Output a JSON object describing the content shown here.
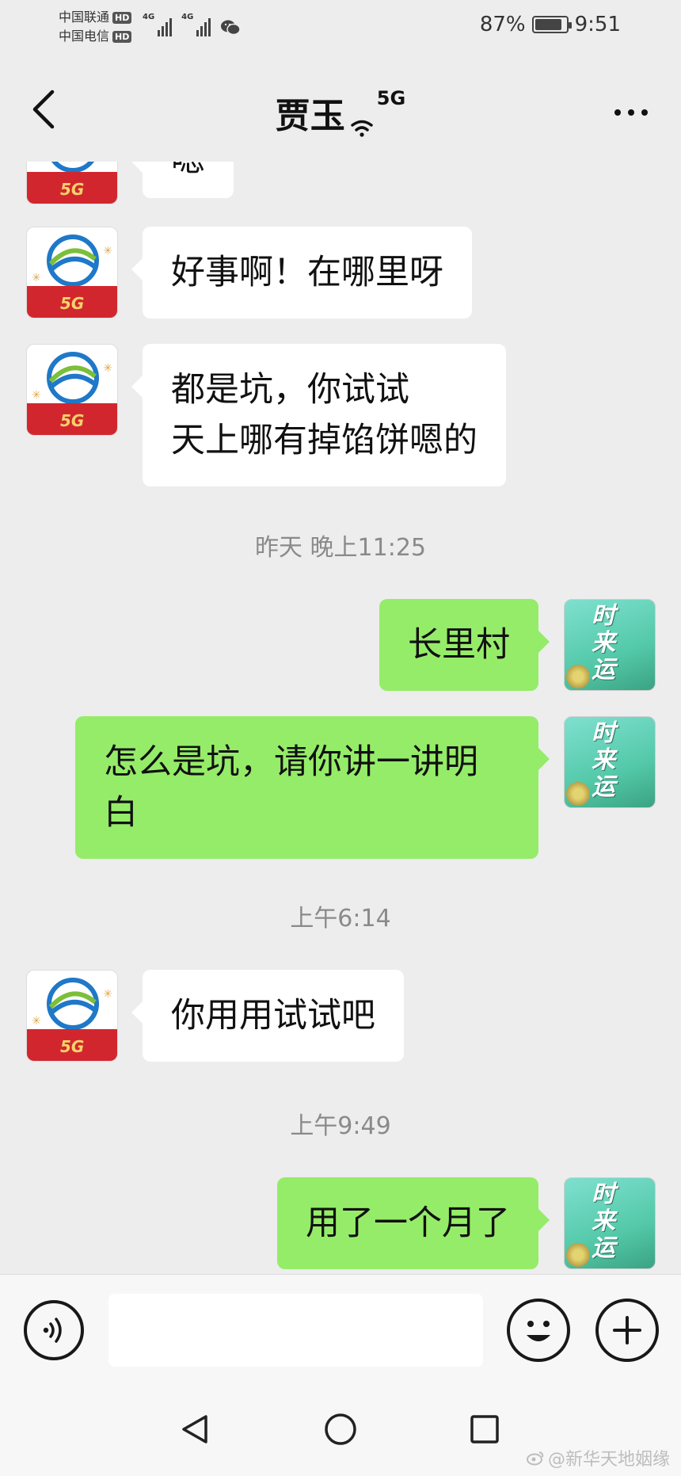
{
  "status_bar": {
    "carrier_1": "中国联通",
    "carrier_2": "中国电信",
    "hd_label": "HD",
    "net_type_1": "4G",
    "net_type_2": "4G",
    "battery_percent": "87%",
    "battery_level": 0.87,
    "time": "9:51"
  },
  "nav": {
    "back_icon": "chevron-left-icon",
    "title": "贾玉",
    "title_badge": "5G",
    "more_icon": "ellipsis-icon"
  },
  "messages": [
    {
      "from": "contact",
      "text": "嗯"
    },
    {
      "from": "contact",
      "text": "好事啊！在哪里呀"
    },
    {
      "from": "contact",
      "lines": [
        "都是坑，你试试",
        "天上哪有掉馅饼嗯的"
      ]
    },
    {
      "type": "timestamp",
      "text": "昨天 晚上11:25"
    },
    {
      "from": "me",
      "text": "长里村"
    },
    {
      "from": "me",
      "lines": [
        "怎么是坑，请你讲一讲明",
        "白"
      ]
    },
    {
      "type": "timestamp",
      "text": "上午6:14"
    },
    {
      "from": "contact",
      "text": "你用用试试吧"
    },
    {
      "type": "timestamp",
      "text": "上午9:49"
    },
    {
      "from": "me",
      "text": "用了一个月了"
    }
  ],
  "avatars": {
    "contact_label": "5G",
    "me_label": "时来运"
  },
  "input_bar": {
    "voice_icon": "voice-icon",
    "input_value": "",
    "emoji_icon": "smiley-icon",
    "plus_icon": "plus-icon"
  },
  "system_nav": {
    "back_icon": "triangle-back-icon",
    "home_icon": "circle-home-icon",
    "recents_icon": "square-recents-icon"
  },
  "watermark": "@新华天地姻缘"
}
